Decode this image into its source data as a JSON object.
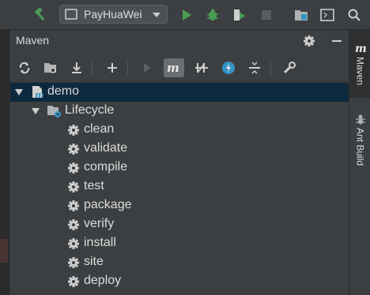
{
  "toolbar": {
    "run_config_label": "PayHuaWei",
    "icons": [
      "hammer-icon",
      "run-config-icon",
      "run-icon",
      "debug-icon",
      "coverage-icon",
      "stop-icon",
      "project-structure-icon",
      "terminal-icon",
      "search-icon"
    ]
  },
  "panel": {
    "title": "Maven",
    "header_icons": [
      "gear-icon",
      "minimize-icon"
    ],
    "tools": [
      "reload-icon",
      "generate-sources-icon",
      "download-icon",
      "add-icon",
      "run-icon",
      "maven-goal-icon",
      "skip-tests-icon",
      "offline-icon",
      "collapse-all-icon",
      "wrench-icon"
    ]
  },
  "tree": {
    "project": "demo",
    "lifecycle": "Lifecycle",
    "goals": [
      "clean",
      "validate",
      "compile",
      "test",
      "package",
      "verify",
      "install",
      "site",
      "deploy"
    ]
  },
  "right_strip": {
    "maven_tab": "Maven",
    "ant_tab": "Ant Build"
  },
  "colors": {
    "green": "#499c54",
    "selection": "#0d293e",
    "maven_blue": "#3592c4"
  }
}
